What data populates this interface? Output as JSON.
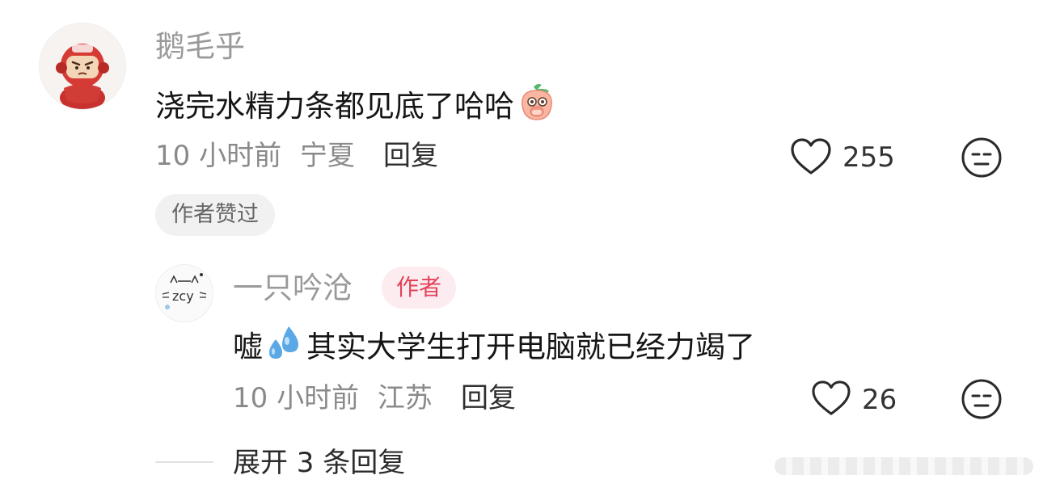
{
  "comment": {
    "avatar_icon": "cartoon-character-avatar",
    "username": "鹅毛乎",
    "text": "浇完水精力条都见底了哈哈",
    "emoji": "peach-face-emoji",
    "time": "10 小时前",
    "location": "宁夏",
    "reply_label": "回复",
    "like_count": "255",
    "like_icon": "heart-icon",
    "dislike_icon": "unamused-face-icon",
    "author_liked_label": "作者赞过"
  },
  "reply": {
    "avatar_icon": "zcy-cat-doodle-avatar",
    "username": "一只吟沧",
    "author_badge": "作者",
    "text_prefix": "嘘",
    "emoji": "sweat-droplets-emoji",
    "text_suffix": "其实大学生打开电脑就已经力竭了",
    "time": "10 小时前",
    "location": "江苏",
    "reply_label": "回复",
    "like_count": "26",
    "like_icon": "heart-icon",
    "dislike_icon": "unamused-face-icon"
  },
  "expand_replies_label": "展开 3 条回复",
  "colors": {
    "author_badge_bg": "#fdecef",
    "author_badge_text": "#e1435a",
    "muted_text": "#9a9a9a"
  }
}
